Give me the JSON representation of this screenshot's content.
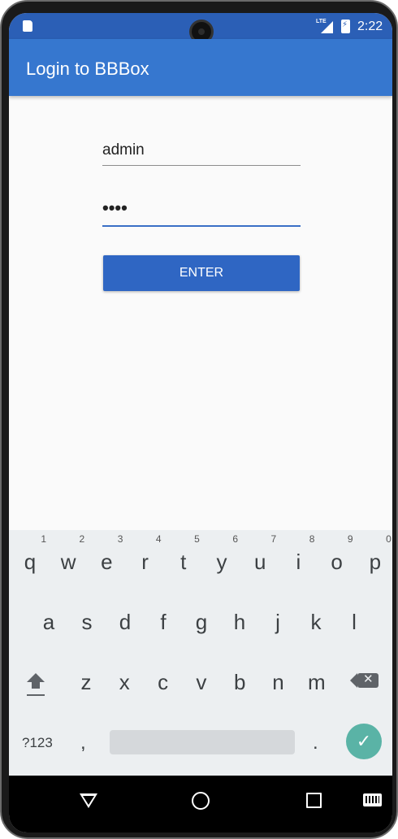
{
  "status_bar": {
    "network": "LTE",
    "time": "2:22",
    "icons": [
      "sd-card-icon",
      "signal-icon",
      "battery-charging-icon"
    ]
  },
  "app_bar": {
    "title": "Login to BBBox"
  },
  "login_form": {
    "username_value": "admin",
    "password_value": "••••",
    "enter_label": "ENTER"
  },
  "keyboard": {
    "row1": [
      {
        "key": "q",
        "hint": "1"
      },
      {
        "key": "w",
        "hint": "2"
      },
      {
        "key": "e",
        "hint": "3"
      },
      {
        "key": "r",
        "hint": "4"
      },
      {
        "key": "t",
        "hint": "5"
      },
      {
        "key": "y",
        "hint": "6"
      },
      {
        "key": "u",
        "hint": "7"
      },
      {
        "key": "i",
        "hint": "8"
      },
      {
        "key": "o",
        "hint": "9"
      },
      {
        "key": "p",
        "hint": "0"
      }
    ],
    "row2": [
      "a",
      "s",
      "d",
      "f",
      "g",
      "h",
      "j",
      "k",
      "l"
    ],
    "row3": [
      "z",
      "x",
      "c",
      "v",
      "b",
      "n",
      "m"
    ],
    "symbols_label": "?123",
    "comma": ",",
    "period": ".",
    "done_icon": "check-icon"
  },
  "nav_bar": {
    "icons": [
      "back-icon",
      "home-icon",
      "recents-icon",
      "keyboard-switch-icon"
    ]
  },
  "colors": {
    "status_bar": "#2b5fb6",
    "app_bar": "#3677cf",
    "button": "#2f66c3",
    "done_key": "#5ab3a6",
    "focus_underline": "#3a6fc6"
  }
}
